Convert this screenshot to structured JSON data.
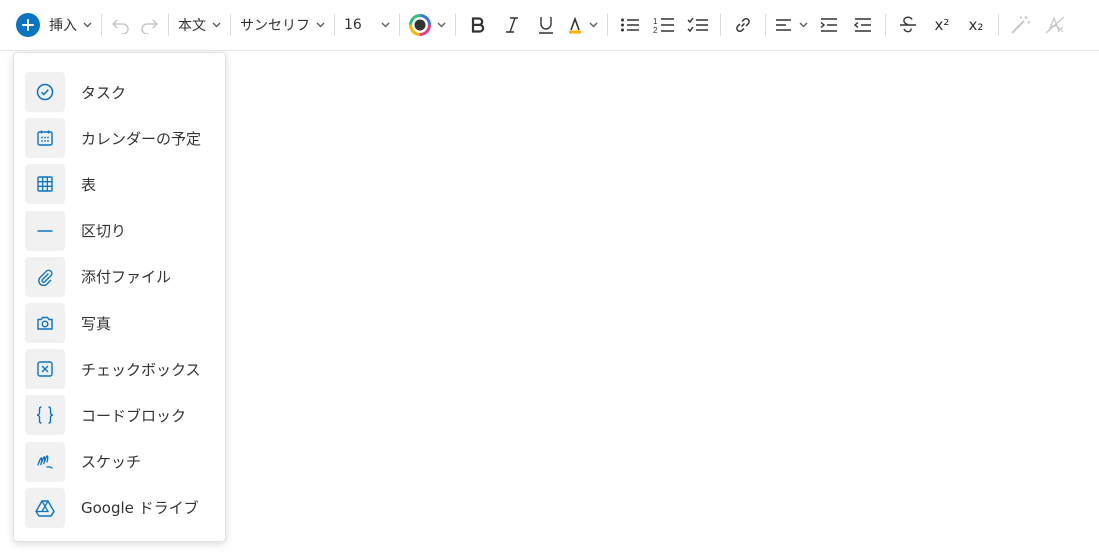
{
  "colors": {
    "accent": "#0a74c4",
    "icon_gray": "#333333",
    "disabled_gray": "#c7c7c7",
    "tile_bg": "#f1f1f1"
  },
  "toolbar": {
    "insert_label": "挿入",
    "style_label": "本文",
    "font_label": "サンセリフ",
    "size_label": "16",
    "superscript_label": "x²",
    "subscript_label": "x₂"
  },
  "insert_menu": {
    "items": [
      {
        "label": "タスク",
        "icon": "task-check-icon"
      },
      {
        "label": "カレンダーの予定",
        "icon": "calendar-icon"
      },
      {
        "label": "表",
        "icon": "table-icon"
      },
      {
        "label": "区切り",
        "icon": "divider-icon"
      },
      {
        "label": "添付ファイル",
        "icon": "paperclip-icon"
      },
      {
        "label": "写真",
        "icon": "camera-icon"
      },
      {
        "label": "チェックボックス",
        "icon": "checkbox-icon"
      },
      {
        "label": "コードブロック",
        "icon": "code-braces-icon"
      },
      {
        "label": "スケッチ",
        "icon": "sketch-icon"
      },
      {
        "label": "Google ドライブ",
        "icon": "google-drive-icon"
      }
    ]
  }
}
